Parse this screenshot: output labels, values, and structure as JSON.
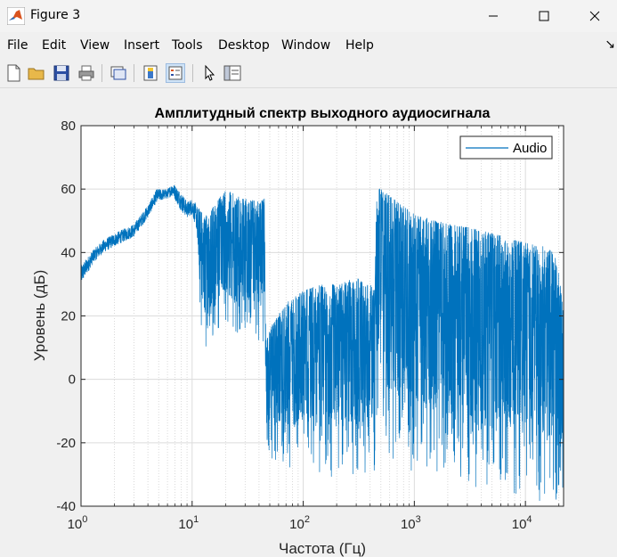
{
  "window": {
    "title": "Figure 3"
  },
  "menu": [
    "File",
    "Edit",
    "View",
    "Insert",
    "Tools",
    "Desktop",
    "Window",
    "Help"
  ],
  "toolbar": [
    "new-figure",
    "open-file",
    "save",
    "print",
    "link-plot",
    "colorbar",
    "legend",
    "edit-plot",
    "property-inspector"
  ],
  "chart_data": {
    "type": "line",
    "title": "Амплитудный спектр выходного аудиосигнала",
    "xlabel": "Частота (Гц)",
    "ylabel": "Уровень (дБ)",
    "xscale": "log",
    "xlim": [
      1,
      22050
    ],
    "ylim": [
      -40,
      80
    ],
    "yticks": [
      -40,
      -20,
      0,
      20,
      40,
      60,
      80
    ],
    "xticks": [
      {
        "base": "10",
        "exp": "0"
      },
      {
        "base": "10",
        "exp": "1"
      },
      {
        "base": "10",
        "exp": "2"
      },
      {
        "base": "10",
        "exp": "3"
      },
      {
        "base": "10",
        "exp": "4"
      }
    ],
    "grid": true,
    "legend": {
      "position": "top-right",
      "entries": [
        "Audio"
      ]
    },
    "series": [
      {
        "name": "Audio",
        "color": "#0072BD",
        "envelope": {
          "x": [
            1,
            1.3,
            1.6,
            2,
            3,
            4,
            4.8,
            6,
            6.7,
            8,
            9,
            10,
            11,
            12,
            13,
            16,
            20,
            25,
            30,
            40,
            45,
            46,
            50,
            70,
            100,
            150,
            200,
            300,
            400,
            440,
            460,
            500,
            700,
            1000,
            2000,
            3000,
            5000,
            8000,
            10000,
            15000,
            18000,
            20000,
            22050
          ],
          "max": [
            36,
            41,
            44,
            46,
            49,
            55,
            60,
            60,
            62,
            59,
            56,
            57,
            55,
            53,
            51,
            55,
            60,
            58,
            57,
            56,
            57,
            12,
            16,
            24,
            28,
            30,
            30,
            32,
            30,
            28,
            62,
            60,
            56,
            52,
            49,
            48,
            46,
            44,
            43,
            42,
            40,
            34,
            20
          ],
          "min": [
            30,
            37,
            40,
            42,
            45,
            51,
            56,
            57,
            58,
            53,
            51,
            52,
            47,
            15,
            5,
            15,
            17,
            12,
            14,
            12,
            10,
            -20,
            -25,
            -30,
            -28,
            -30,
            -32,
            -32,
            -30,
            -38,
            -10,
            -22,
            -26,
            -30,
            -35,
            -36,
            -38,
            -38,
            -38,
            -39,
            -39,
            -40,
            -40
          ]
        }
      }
    ]
  }
}
